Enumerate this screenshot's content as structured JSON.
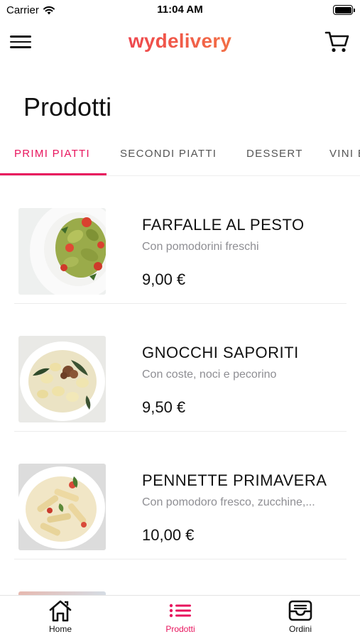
{
  "status_bar": {
    "carrier": "Carrier",
    "time": "11:04 AM"
  },
  "header": {
    "logo": "wydelivery",
    "menu_icon": "hamburger-menu-icon",
    "cart_icon": "shopping-cart-icon"
  },
  "page_title": "Prodotti",
  "tabs": [
    {
      "label": "PRIMI PIATTI",
      "active": true
    },
    {
      "label": "SECONDI PIATTI",
      "active": false
    },
    {
      "label": "DESSERT",
      "active": false
    },
    {
      "label": "VINI E BIBITE",
      "active": false
    }
  ],
  "products": [
    {
      "name": "FARFALLE AL PESTO",
      "description": "Con pomodorini freschi",
      "price": "9,00 €",
      "image": "farfalle-pesto-photo"
    },
    {
      "name": "GNOCCHI SAPORITI",
      "description": "Con coste, noci e pecorino",
      "price": "9,50 €",
      "image": "gnocchi-photo"
    },
    {
      "name": "PENNETTE PRIMAVERA",
      "description": "Con pomodoro fresco, zucchine,...",
      "price": "10,00 €",
      "image": "pennette-photo"
    }
  ],
  "tab_bar": [
    {
      "label": "Home",
      "icon": "home-icon",
      "active": false
    },
    {
      "label": "Prodotti",
      "icon": "list-icon",
      "active": true
    },
    {
      "label": "Ordini",
      "icon": "inbox-tray-icon",
      "active": false
    }
  ],
  "colors": {
    "accent": "#e8145d",
    "logo_gradient_end": "#f6a13c",
    "muted_text": "#8e8e93"
  }
}
